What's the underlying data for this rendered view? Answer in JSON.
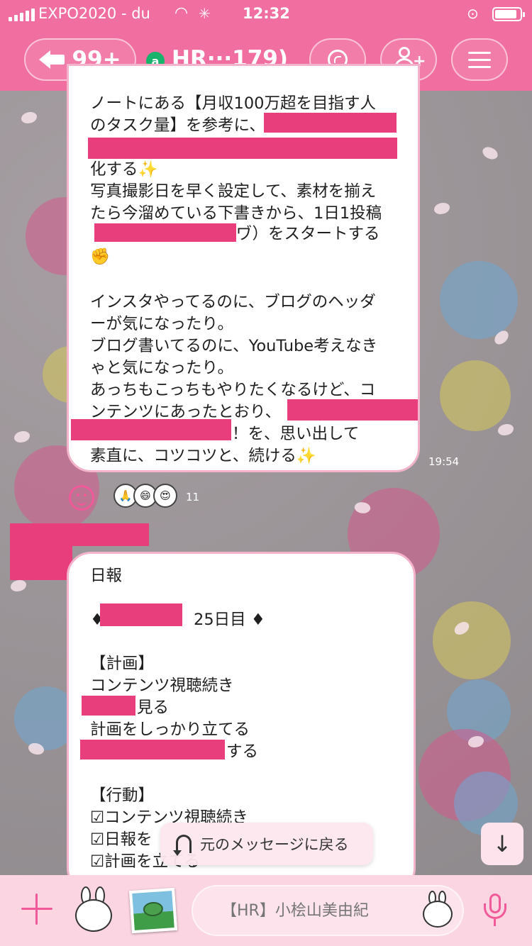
{
  "status_bar": {
    "carrier": "EXPO2020 - du",
    "time": "12:32"
  },
  "header": {
    "back_count": "99+",
    "official_badge": "a",
    "chat_title": "HR···179)"
  },
  "messages": [
    {
      "lines": [
        "ノートにある【月収100万超を目指す人",
        "のタスク量】を参考に、",
        "",
        "化する✨",
        "写真撮影日を早く設定して、素材を揃え",
        "たら今溜めている下書きから、1日1投稿",
        "ヷ）をスタートする",
        "✊",
        "",
        "インスタやってるのに、ブログのヘッダ",
        "ーが気になったり。",
        "ブログ書いてるのに、YouTube考えなき",
        "ゃと気になったり。",
        "あっちもこっちもやりたくなるけど、コ",
        "ンテンツにあったとおり、",
        "！を、思い出して",
        "素直に、コツコツと、続ける✨"
      ],
      "time": "19:54",
      "reaction_count": "11",
      "reaction_emojis": [
        "🙏",
        "😄",
        "😍"
      ]
    },
    {
      "lines": [
        "日報",
        "",
        "♦",
        "25日目 ♦",
        "",
        "【計画】",
        "コンテンツ視聴続き",
        "見る",
        "計画をしっかり立てる",
        "する",
        "",
        "【行動】",
        "☑コンテンツ視聴続き",
        "☑日報を",
        "☑計画を立てる"
      ]
    }
  ],
  "jump_banner": {
    "label": "元のメッセージに戻る"
  },
  "composer": {
    "placeholder": "【HR】小桧山美由紀"
  },
  "colors": {
    "header_pink": "#f16fa0",
    "redaction": "#e83e7c",
    "bubble_border": "#f3b3ca",
    "composer_bg": "#fbd5e2"
  }
}
